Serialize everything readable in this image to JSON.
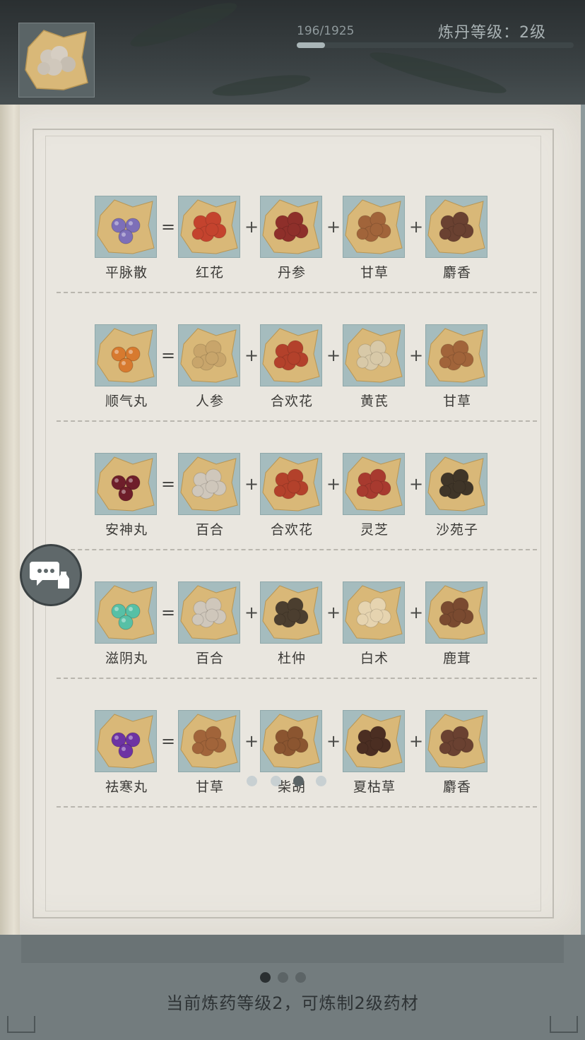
{
  "header": {
    "progress_text": "196/1925",
    "progress_value": 0.1018,
    "level_text": "炼丹等级：2级",
    "slot_icon": "baihe-herb-icon"
  },
  "recipes": [
    {
      "result": {
        "label": "平脉散",
        "icon": "pingmaisan-icon",
        "color": "#7d6fb8"
      },
      "ingredients": [
        {
          "label": "红花",
          "icon": "honghua-icon",
          "color": "#c4432e"
        },
        {
          "label": "丹参",
          "icon": "danshen-icon",
          "color": "#8e2f2a"
        },
        {
          "label": "甘草",
          "icon": "gancao-icon",
          "color": "#a1643a"
        },
        {
          "label": "麝香",
          "icon": "shexiang-icon",
          "color": "#6a4131"
        }
      ]
    },
    {
      "result": {
        "label": "顺气丸",
        "icon": "shunqiwan-icon",
        "color": "#d77a2f"
      },
      "ingredients": [
        {
          "label": "人参",
          "icon": "renshen-icon",
          "color": "#c8a56b"
        },
        {
          "label": "合欢花",
          "icon": "hehuanhua-icon",
          "color": "#b3412b"
        },
        {
          "label": "黄芪",
          "icon": "huangqi-icon",
          "color": "#d8c9a8"
        },
        {
          "label": "甘草",
          "icon": "gancao-icon",
          "color": "#a1643a"
        }
      ]
    },
    {
      "result": {
        "label": "安神丸",
        "icon": "anshenwan-icon",
        "color": "#6e1e2a"
      },
      "ingredients": [
        {
          "label": "百合",
          "icon": "baihe-icon",
          "color": "#cfc7bb"
        },
        {
          "label": "合欢花",
          "icon": "hehuanhua-icon",
          "color": "#b3412b"
        },
        {
          "label": "灵芝",
          "icon": "lingzhi-icon",
          "color": "#a83a2f"
        },
        {
          "label": "沙苑子",
          "icon": "shayuanzi-icon",
          "color": "#3f3528"
        }
      ]
    },
    {
      "result": {
        "label": "滋阴丸",
        "icon": "ziyinwan-icon",
        "color": "#57c0a6"
      },
      "ingredients": [
        {
          "label": "百合",
          "icon": "baihe-icon",
          "color": "#cfc7bb"
        },
        {
          "label": "杜仲",
          "icon": "duzhong-icon",
          "color": "#4b3e2f"
        },
        {
          "label": "白术",
          "icon": "baizhu-icon",
          "color": "#e6d4b0"
        },
        {
          "label": "鹿茸",
          "icon": "lurong-icon",
          "color": "#7a4a30"
        }
      ]
    },
    {
      "result": {
        "label": "祛寒丸",
        "icon": "quhanwan-icon",
        "color": "#6d33a3"
      },
      "ingredients": [
        {
          "label": "甘草",
          "icon": "gancao-icon",
          "color": "#a1643a"
        },
        {
          "label": "柴胡",
          "icon": "chaihu-icon",
          "color": "#8b5530"
        },
        {
          "label": "夏枯草",
          "icon": "xiakucao-icon",
          "color": "#4b2e22"
        },
        {
          "label": "麝香",
          "icon": "shexiang-icon",
          "color": "#6a4131"
        }
      ]
    }
  ],
  "operators": {
    "equals": "=",
    "plus": "+"
  },
  "book_pages": {
    "count": 4,
    "active": 2
  },
  "footer": {
    "page_count": 3,
    "page_active": 0,
    "text": "当前炼药等级2，可炼制2级药材"
  },
  "colors": {
    "card_bg": "#a5bcbe",
    "paper": "#d9b878",
    "book_bg": "#e9e6df"
  }
}
